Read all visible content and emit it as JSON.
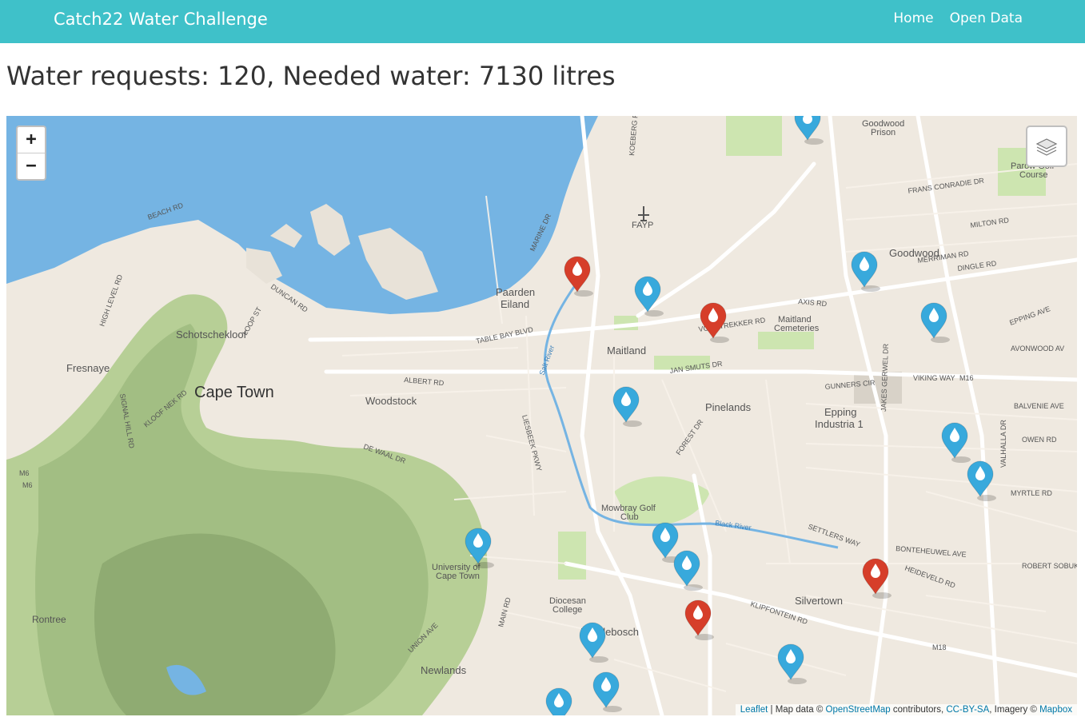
{
  "app": {
    "brand": "Catch22 Water Challenge",
    "nav": [
      "Home",
      "Open Data"
    ]
  },
  "summary": {
    "headline": "Water requests: 120, Needed water: 7130 litres"
  },
  "map": {
    "zoom_in": "+",
    "zoom_out": "−",
    "layers_icon": "layers-icon",
    "places": {
      "cape_town": "Cape Town",
      "schotschekloof": "Schotschekloof",
      "fresnaye": "Fresnaye",
      "woodstock": "Woodstock",
      "paarden_eiland": [
        "Paarden",
        "Eiland"
      ],
      "maitland": "Maitland",
      "maitland_cemeteries": [
        "Maitland",
        "Cemeteries"
      ],
      "pinelands": "Pinelands",
      "epping": [
        "Epping",
        "Industria 1"
      ],
      "goodwood": "Goodwood",
      "goodwood_prison": [
        "Goodwood",
        "Prison"
      ],
      "parow_golf": [
        "Parow Golf",
        "Course"
      ],
      "fayp": "FAYP",
      "mowbray": [
        "Mowbray Golf",
        "Club"
      ],
      "uct": [
        "University of",
        "Cape Town"
      ],
      "diocesan": [
        "Diocesan",
        "College"
      ],
      "rondebosch": "Rondebosch",
      "newlands": "Newlands",
      "silvertown": "Silvertown",
      "rontree": "Rontree"
    },
    "roads": {
      "beach_rd": "BEACH RD",
      "duncan_rd": "DUNCAN RD",
      "loop_st": "LOOP ST",
      "marine_dr": "MARINE DR",
      "table_bay_blvd": "TABLE BAY BLVD",
      "albert_rd": "ALBERT RD",
      "jan_smuts_dr": "JAN SMUTS DR",
      "voortrekker_rd": "VOORTREKKER RD",
      "axis_rd": "AXIS RD",
      "gunners_cir": "GUNNERS CIR",
      "viking_way": "VIKING WAY",
      "m16": "M16",
      "epping_ave": "EPPING AVE",
      "avonwood_ave": "AVONWOOD AV",
      "balvenie_ave": "BALVENIE AVE",
      "owen_rd": "OWEN RD",
      "myrtle_rd": "MYRTLE RD",
      "settlers_way": "SETTLERS WAY",
      "klipfontein_rd": "KLIPFONTEIN RD",
      "m18": "M18",
      "de_waal_dr": "DE WAAL DR",
      "kloof_nek_rd": "KLOOF NEK RD",
      "signal_hill_rd": "SIGNAL HILL RD",
      "main_rd": "MAIN RD",
      "union_ave": "UNION AVE",
      "m6": "M6",
      "black_river": "Black River",
      "salt_river": "Salt River",
      "liesbeek_pkwy": "LIESBEEK PKWY",
      "forest_dr": "FOREST DR",
      "merriman_rd": "MERRIMAN RD",
      "dingle_rd": "DINGLE RD",
      "frans_conradie_dr": "FRANS CONRADIE DR",
      "milton_rd": "MILTON RD",
      "jakes_gerwel_dr": "JAKES GERWEL DR",
      "high_level_rd": "HIGH LEVEL RD",
      "koeberg_rd": "KOEBERG RD",
      "bonteheuwel_ave": "BONTEHEUWEL AVE",
      "heideveld_rd": "HEIDEVELD RD",
      "robert_sobukwe": "ROBERT SOBUK",
      "valhalla_dr": "VALHALLA DR"
    },
    "markers": [
      {
        "status": "blue"
      },
      {
        "status": "red"
      },
      {
        "status": "blue"
      },
      {
        "status": "red"
      },
      {
        "status": "blue"
      },
      {
        "status": "blue"
      },
      {
        "status": "blue"
      },
      {
        "status": "blue"
      },
      {
        "status": "blue"
      },
      {
        "status": "blue"
      },
      {
        "status": "blue"
      },
      {
        "status": "blue"
      },
      {
        "status": "red"
      },
      {
        "status": "red"
      },
      {
        "status": "blue"
      },
      {
        "status": "blue"
      },
      {
        "status": "blue"
      },
      {
        "status": "blue"
      }
    ],
    "colors": {
      "marker_blue": "#38a9dc",
      "marker_red": "#d63e2a"
    },
    "attribution": {
      "leaflet": "Leaflet",
      "sep1": " | Map data © ",
      "osm": "OpenStreetMap",
      "sep2": " contributors, ",
      "ccbysa": "CC-BY-SA",
      "sep3": ", Imagery © ",
      "mapbox": "Mapbox"
    }
  }
}
